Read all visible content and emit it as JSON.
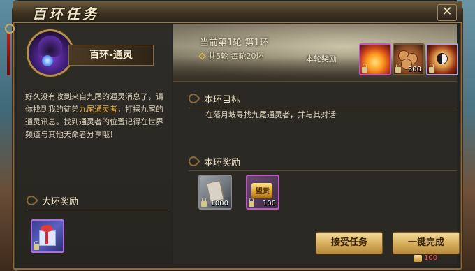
{
  "window": {
    "title": "百环任务",
    "close_glyph": "✕"
  },
  "npc": {
    "name": "百环-通灵",
    "description_parts": [
      "好久没有收到来自九尾的通灵消息了，请你找到我的徒弟",
      "九尾通灵者",
      "，打探九尾的通灵讯息。找到通灵者的位置记得在世界频道与其他天命者分享哦！"
    ]
  },
  "big_reward": {
    "label": "大环奖励",
    "items": [
      {
        "icon": "gift-box-icon",
        "locked": true
      }
    ]
  },
  "round": {
    "current": "当前第1轮 第1环",
    "total": "共5轮 每轮20环",
    "reward_label": "本轮奖励",
    "items": [
      {
        "icon": "fire-icon",
        "locked": true,
        "count": ""
      },
      {
        "icon": "coins-icon",
        "locked": true,
        "count": "300"
      },
      {
        "icon": "bagua-icon",
        "locked": true,
        "count": ""
      }
    ]
  },
  "goal": {
    "label": "本环目标",
    "text": "在落月坡寻找九尾通灵者，并与其对话"
  },
  "ring_reward": {
    "label": "本环奖励",
    "items": [
      {
        "icon": "scroll-icon",
        "locked": true,
        "count": "1000"
      },
      {
        "icon": "alliance-gold-icon",
        "text": "盟贡",
        "locked": true,
        "count": "100"
      }
    ]
  },
  "actions": {
    "accept": "接受任务",
    "finish": "一键完成",
    "finish_cost": "100"
  },
  "colors": {
    "highlight": "#f0b040",
    "cost": "#ff5050",
    "frame": "#8a6a3e"
  }
}
